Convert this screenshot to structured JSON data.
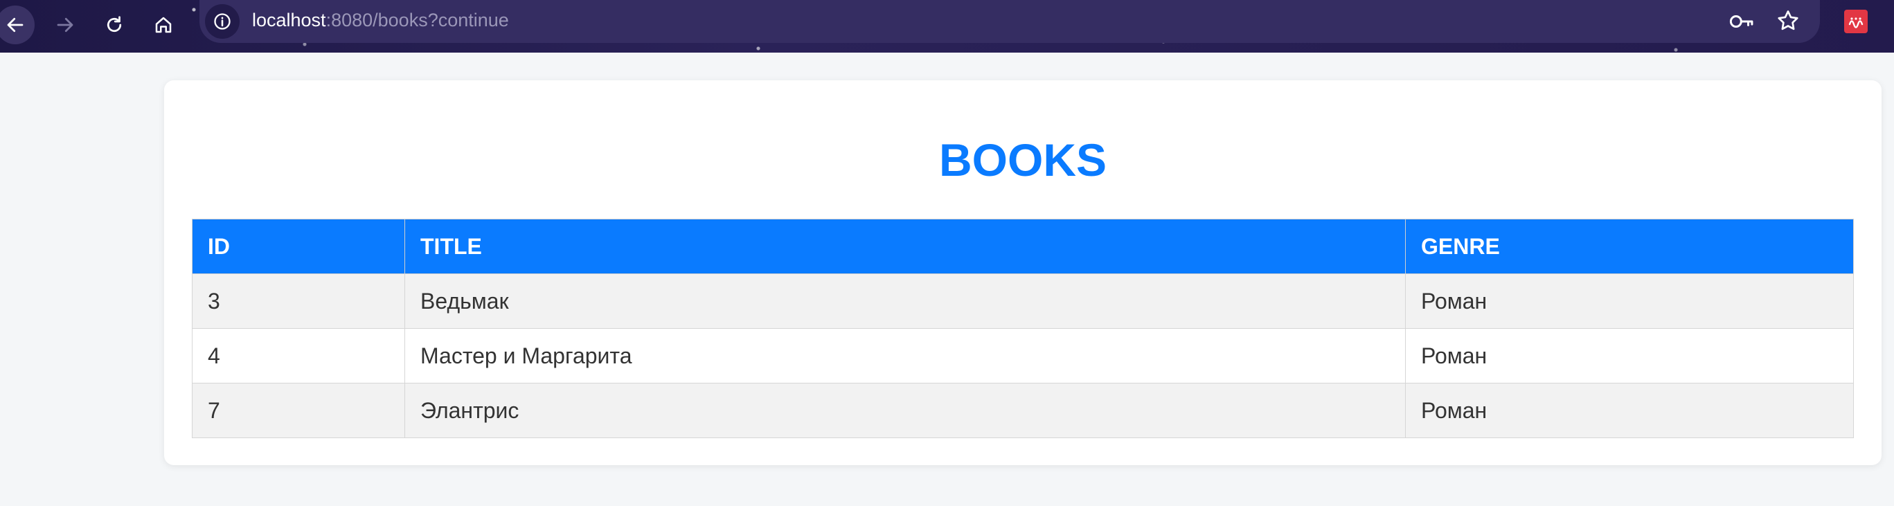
{
  "browser": {
    "url_host": "localhost",
    "url_rest": ":8080/books?continue"
  },
  "page": {
    "title": "BOOKS",
    "table": {
      "headers": [
        "ID",
        "TITLE",
        "GENRE"
      ],
      "rows": [
        [
          "3",
          "Ведьмак",
          "Роман"
        ],
        [
          "4",
          "Мастер и Маргарита",
          "Роман"
        ],
        [
          "7",
          "Элантрис",
          "Роман"
        ]
      ]
    }
  },
  "colors": {
    "accent": "#0a7bff",
    "chrome_bg": "#231b4d",
    "row_alt": "#f2f2f2"
  },
  "icons": [
    "back-arrow-icon",
    "forward-arrow-icon",
    "reload-icon",
    "home-icon",
    "site-info-icon",
    "key-icon",
    "star-icon",
    "extension-icon"
  ]
}
